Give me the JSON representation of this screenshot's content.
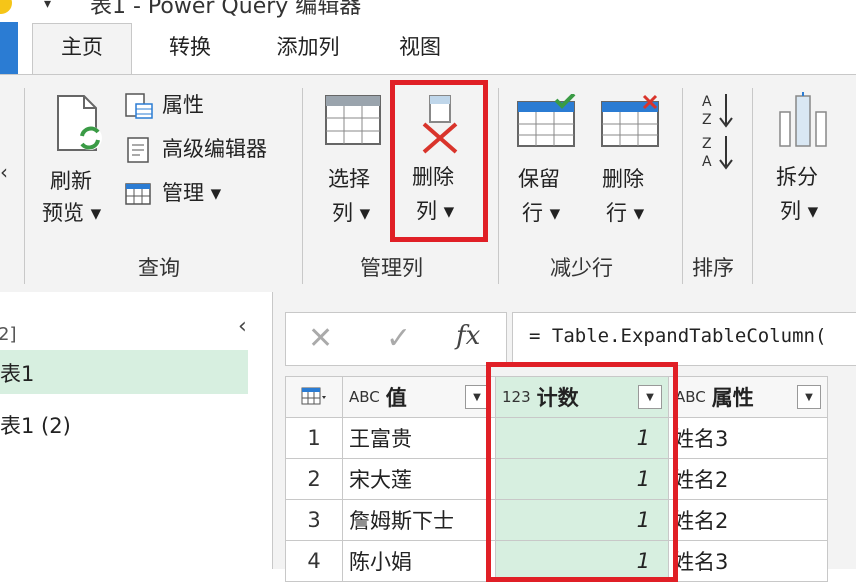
{
  "window": {
    "title": "表1 - Power Query 编辑器"
  },
  "tabs": [
    {
      "label": "主页",
      "active": true
    },
    {
      "label": "转换"
    },
    {
      "label": "添加列"
    },
    {
      "label": "视图"
    }
  ],
  "ribbon": {
    "query_group": {
      "label": "查询",
      "refresh_line1": "刷新",
      "refresh_line2": "预览 ▾",
      "properties": "属性",
      "advanced_editor": "高级编辑器",
      "manage": "管理 ▾"
    },
    "manage_columns_group": {
      "label": "管理列",
      "choose_line1": "选择",
      "choose_line2": "列 ▾",
      "remove_line1": "删除",
      "remove_line2": "列 ▾"
    },
    "reduce_rows_group": {
      "label": "减少行",
      "keep_line1": "保留",
      "keep_line2": "行 ▾",
      "remove_line1": "删除",
      "remove_line2": "行 ▾"
    },
    "sort_group": {
      "label": "排序"
    },
    "split": {
      "line1": "拆分",
      "line2": "列 ▾"
    }
  },
  "queries_panel": {
    "header_fragment": "2]",
    "items": [
      {
        "label": "表1",
        "selected": true
      },
      {
        "label": "表1 (2)"
      }
    ]
  },
  "formula_bar": {
    "fx_label": "fx",
    "formula": "= Table.ExpandTableColumn("
  },
  "table": {
    "columns": [
      {
        "type": "ABC",
        "name": "值"
      },
      {
        "type": "123",
        "name": "计数"
      },
      {
        "type": "ABC",
        "name": "属性"
      }
    ],
    "rows": [
      {
        "n": "1",
        "value": "王富贵",
        "count": "1",
        "attr": "姓名3"
      },
      {
        "n": "2",
        "value": "宋大莲",
        "count": "1",
        "attr": "姓名2"
      },
      {
        "n": "3",
        "value": "詹姆斯下士",
        "count": "1",
        "attr": "姓名2"
      },
      {
        "n": "4",
        "value": "陈小娟",
        "count": "1",
        "attr": "姓名3"
      }
    ]
  },
  "colors": {
    "accent_blue": "#2b7cd3",
    "highlight_red": "#e01f26",
    "selected_green": "#d7efe0"
  }
}
